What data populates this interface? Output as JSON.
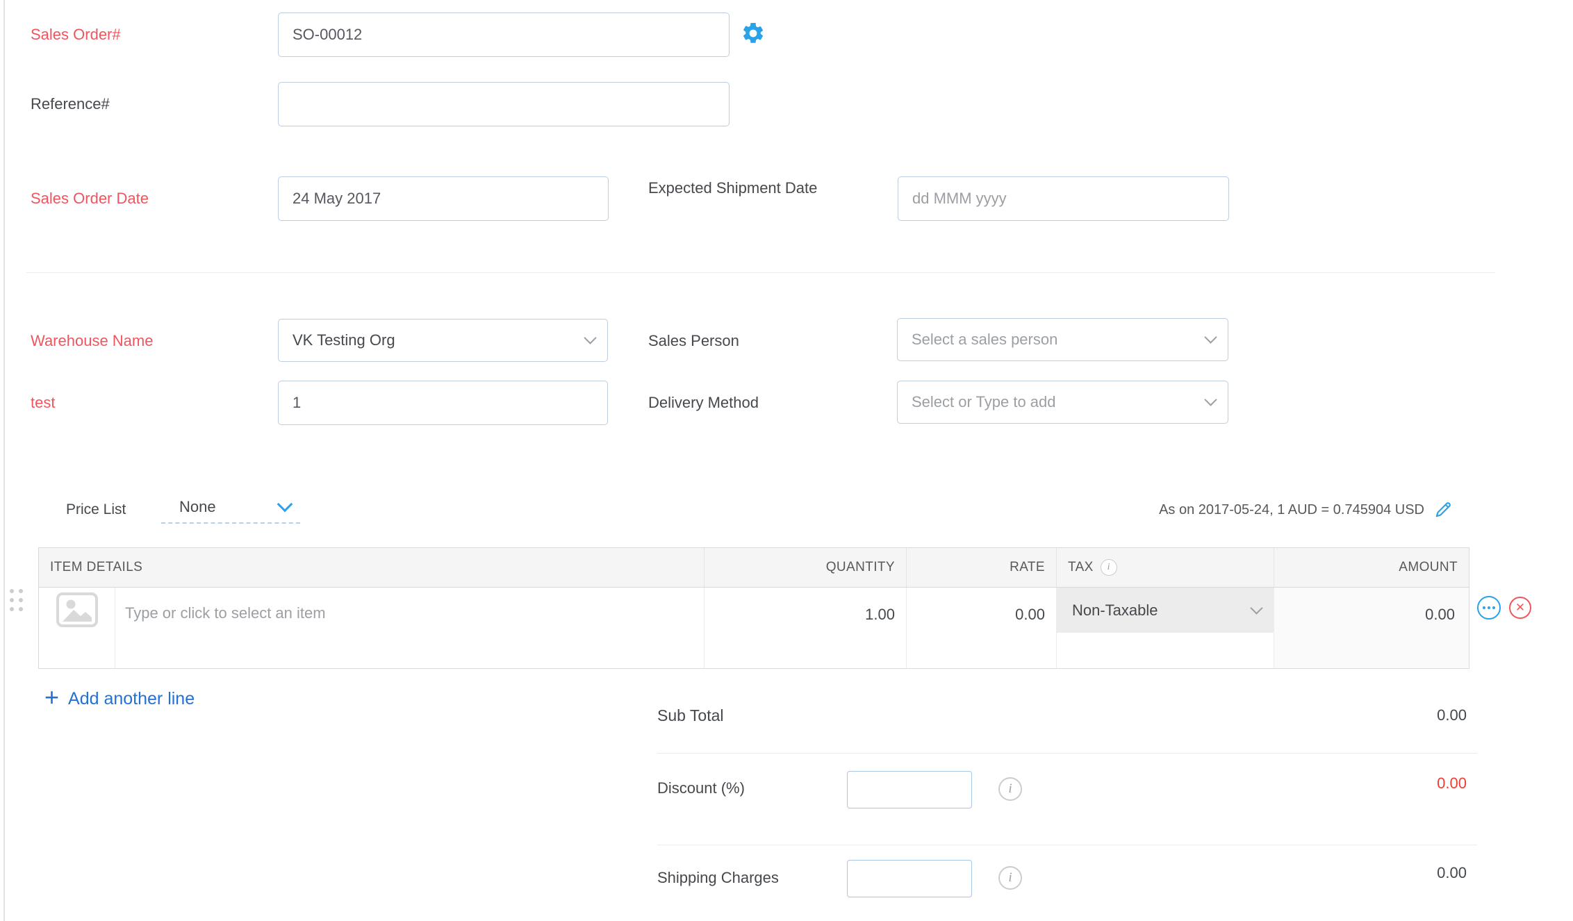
{
  "colors": {
    "required_label": "#f0555f",
    "accent_blue": "#29a2e8",
    "link_blue": "#2471d6",
    "danger_red": "#ee3f35",
    "text_dark": "#45484d",
    "border_input": "#bccee0"
  },
  "form": {
    "sales_order_number": {
      "label": "Sales Order#",
      "value": "SO-00012"
    },
    "reference_number": {
      "label": "Reference#",
      "value": ""
    },
    "sales_order_date": {
      "label": "Sales Order Date",
      "value": "24 May 2017"
    },
    "expected_shipment_date": {
      "label": "Expected Shipment Date",
      "value": "",
      "placeholder": "dd MMM yyyy"
    },
    "warehouse_name": {
      "label": "Warehouse Name",
      "value": "VK Testing Org"
    },
    "custom_field_test": {
      "label": "test",
      "value": "1"
    },
    "sales_person": {
      "label": "Sales Person",
      "placeholder": "Select a sales person"
    },
    "delivery_method": {
      "label": "Delivery Method",
      "placeholder": "Select or Type to add"
    }
  },
  "price_list": {
    "label": "Price List",
    "value": "None"
  },
  "exchange_rate_note": "As on 2017-05-24, 1 AUD = 0.745904 USD",
  "items_table": {
    "headers": {
      "item_details": "ITEM DETAILS",
      "quantity": "QUANTITY",
      "rate": "RATE",
      "tax": "TAX",
      "amount": "AMOUNT"
    },
    "rows": [
      {
        "item_placeholder": "Type or click to select an item",
        "quantity": "1.00",
        "rate": "0.00",
        "tax": "Non-Taxable",
        "amount": "0.00"
      }
    ]
  },
  "actions": {
    "add_line_plus": "+",
    "add_line": "Add another line",
    "delete_glyph": "✕"
  },
  "totals": {
    "sub_total": {
      "label": "Sub Total",
      "value": "0.00"
    },
    "discount": {
      "label": "Discount (%)",
      "input_value": "",
      "value": "0.00"
    },
    "shipping": {
      "label": "Shipping Charges",
      "input_value": "",
      "value": "0.00"
    }
  },
  "icons": {
    "settings": "gear-icon",
    "exchange_rate_edit": "pencil-icon",
    "tax_info": "info-icon",
    "discount_info": "info-icon",
    "shipping_info": "info-icon",
    "item_image": "image-placeholder-icon",
    "row_reorder": "grip-dots-icon",
    "row_more": "ellipsis-circle-icon",
    "row_delete": "x-circle-icon",
    "dropdown": "chevron-down-icon",
    "info_glyph": "i"
  }
}
